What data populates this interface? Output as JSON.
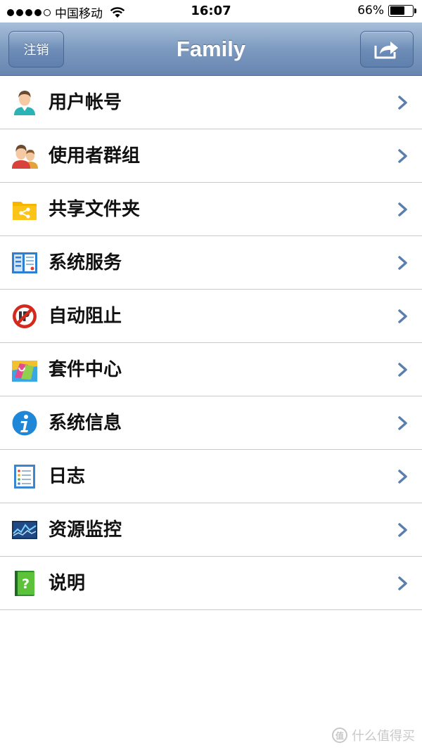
{
  "status_bar": {
    "carrier": "中国移动",
    "time": "16:07",
    "battery_percent": "66%",
    "battery_level": 0.66,
    "signal_dots_filled": 4,
    "signal_dots_total": 5,
    "icons": [
      "signal-dots-icon",
      "wifi-icon",
      "battery-icon"
    ]
  },
  "navbar": {
    "title": "Family",
    "logout_label": "注销",
    "share_icon": "share-icon"
  },
  "menu": {
    "items": [
      {
        "label": "用户帐号",
        "icon": "user-account-icon"
      },
      {
        "label": "使用者群组",
        "icon": "user-group-icon"
      },
      {
        "label": "共享文件夹",
        "icon": "shared-folder-icon"
      },
      {
        "label": "系统服务",
        "icon": "system-service-icon"
      },
      {
        "label": "自动阻止",
        "icon": "auto-block-icon"
      },
      {
        "label": "套件中心",
        "icon": "package-center-icon"
      },
      {
        "label": "系统信息",
        "icon": "info-icon"
      },
      {
        "label": "日志",
        "icon": "log-icon"
      },
      {
        "label": "资源监控",
        "icon": "resource-monitor-icon"
      },
      {
        "label": "说明",
        "icon": "help-icon"
      }
    ]
  },
  "watermark": {
    "text": "什么值得买"
  },
  "colors": {
    "nav_top": "#a8bfd9",
    "nav_bottom": "#6785b0",
    "chevron": "#5b7fad",
    "separator": "#c8c7cc"
  }
}
